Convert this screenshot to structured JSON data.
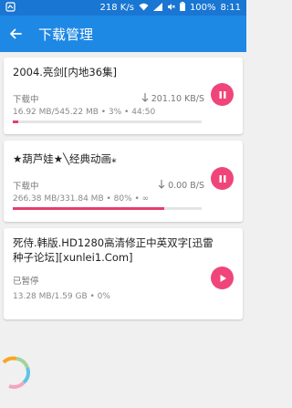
{
  "status": {
    "speed": "218 K/s",
    "battery": "100%",
    "time": "8:11"
  },
  "header": {
    "title": "下载管理"
  },
  "tasks": [
    {
      "title": "2004.亮剑[内地36集]",
      "state": "下载中",
      "speed": "201.10 KB/S",
      "info": "16.92 MB/545.22 MB • 3% • 44:50",
      "progress": 0.03,
      "action": "pause"
    },
    {
      "title": "★葫芦娃★╲经典动画⁎",
      "state": "下载中",
      "speed": "0.00 B/S",
      "info": "266.38 MB/331.84 MB • 80% • ∞",
      "progress": 0.8,
      "action": "pause"
    },
    {
      "title": "死侍.韩版.HD1280高清修正中英双字[迅雷种子论坛][xunlei1.Com]",
      "state": "已暂停",
      "speed": "",
      "info": "13.28 MB/1.59 GB • 0%",
      "progress": 0.0,
      "action": "play"
    }
  ],
  "colors": {
    "status_bar": "#1976d2",
    "app_bar": "#1e88e5",
    "accent": "#f0457a",
    "progress": "#e53d6f"
  }
}
